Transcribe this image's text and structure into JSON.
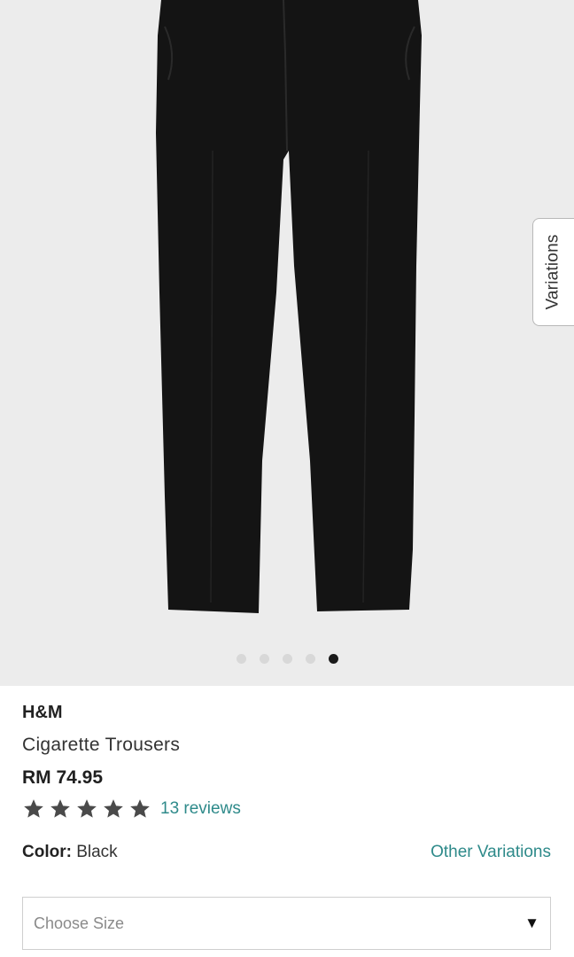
{
  "product": {
    "brand": "H&M",
    "name": "Cigarette Trousers",
    "price": "RM 74.95",
    "rating": 5,
    "reviews_label": "13 reviews",
    "color_label": "Color:",
    "color_value": "Black",
    "other_variations_label": "Other Variations",
    "size_placeholder": "Choose Size",
    "size_caret": "▼"
  },
  "gallery": {
    "variations_tab_label": "Variations",
    "image_count": 5,
    "active_index": 4
  },
  "colors": {
    "accent": "#2e8a8a",
    "star": "#4a4a4a",
    "hero_bg": "#ececec",
    "garment": "#141414"
  }
}
